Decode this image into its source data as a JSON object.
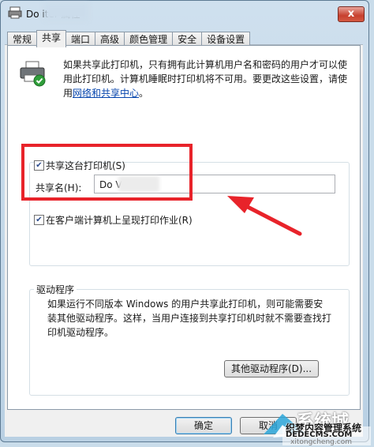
{
  "window": {
    "title": "Do      iter 属性",
    "close_label": "x"
  },
  "tabs": [
    {
      "label": "常规"
    },
    {
      "label": "共享"
    },
    {
      "label": "端口"
    },
    {
      "label": "高级"
    },
    {
      "label": "颜色管理"
    },
    {
      "label": "安全"
    },
    {
      "label": "设备设置"
    }
  ],
  "active_tab": "共享",
  "info": {
    "text": "如果共享此打印机，只有拥有此计算机用户名和密码的用户才可以使用此打印机。计算机睡眠时打印机将不可用。要更改这些设置，请使用",
    "link": "网络和共享中心",
    "suffix": "。"
  },
  "share": {
    "checkbox_label": "共享这台打印机(S)",
    "checked": true,
    "name_label": "共享名(H):",
    "name_value": "Do              Vriter"
  },
  "render": {
    "checkbox_label": "在客户端计算机上呈现打印作业(R)",
    "checked": true
  },
  "drivers": {
    "title": "驱动程序",
    "text": "如果运行不同版本 Windows 的用户共享此打印机，则可能需要安装其他驱动程序。这样，当用户连接到共享打印机时就不需要查找打印机驱动程序。",
    "button": "其他驱动程序(D)..."
  },
  "buttons": {
    "ok": "确定",
    "cancel": "取消"
  },
  "watermark": {
    "line1": "系统城",
    "line2": "织梦内容管理系统",
    "line3": "DEDECMS.COM",
    "line4": "xitongcheng.com"
  },
  "colors": {
    "highlight_box": "#e8232a",
    "link": "#0645ad"
  }
}
